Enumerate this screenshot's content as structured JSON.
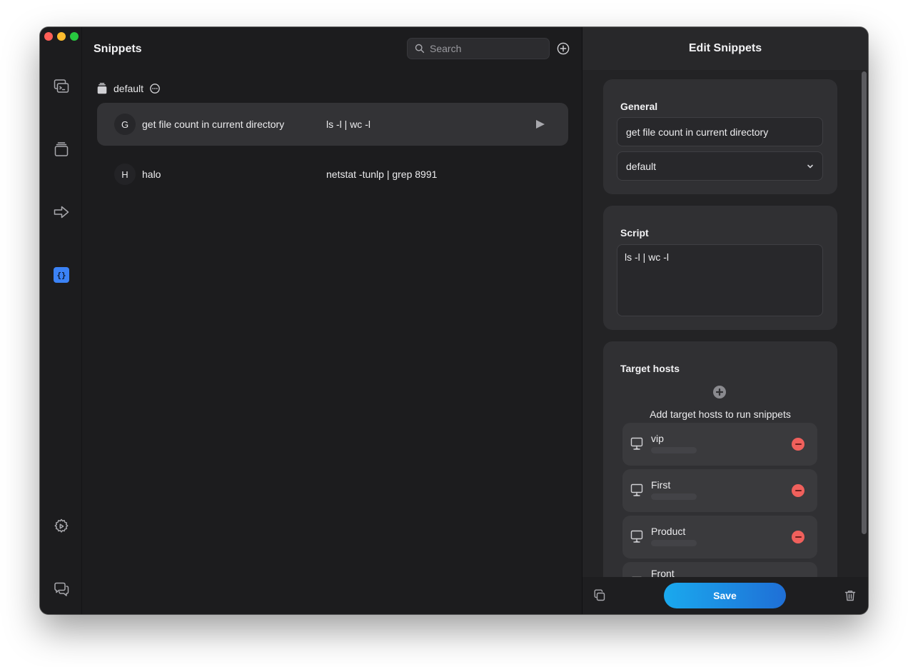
{
  "app": {
    "list_title": "Snippets",
    "edit_title": "Edit Snippets"
  },
  "search": {
    "placeholder": "Search"
  },
  "group": {
    "name": "default"
  },
  "snippets": [
    {
      "initial": "G",
      "name": "get file count in current directory",
      "command": "ls -l | wc -l",
      "selected": true
    },
    {
      "initial": "H",
      "name": "halo",
      "command": "netstat -tunlp | grep 8991",
      "selected": false
    }
  ],
  "edit": {
    "general_label": "General",
    "name_value": "get file count in current directory",
    "group_value": "default",
    "script_label": "Script",
    "script_value": "ls -l | wc -l",
    "target_hosts_label": "Target hosts",
    "add_hosts_text": "Add target hosts to run snippets",
    "hosts": [
      {
        "name": "vip"
      },
      {
        "name": "First"
      },
      {
        "name": "Product"
      },
      {
        "name": "Front"
      }
    ],
    "save_label": "Save"
  },
  "sidebar": {
    "items": [
      {
        "icon": "terminal-windows-icon"
      },
      {
        "icon": "stack-icon"
      },
      {
        "icon": "arrow-forward-icon"
      },
      {
        "icon": "braces-icon"
      },
      {
        "icon": "gear-play-icon"
      },
      {
        "icon": "chat-bubbles-icon"
      }
    ]
  },
  "colors": {
    "accent": "#3b82f6",
    "save_start": "#1aa9ee",
    "save_end": "#1f6fd6",
    "remove": "#f0605c"
  }
}
